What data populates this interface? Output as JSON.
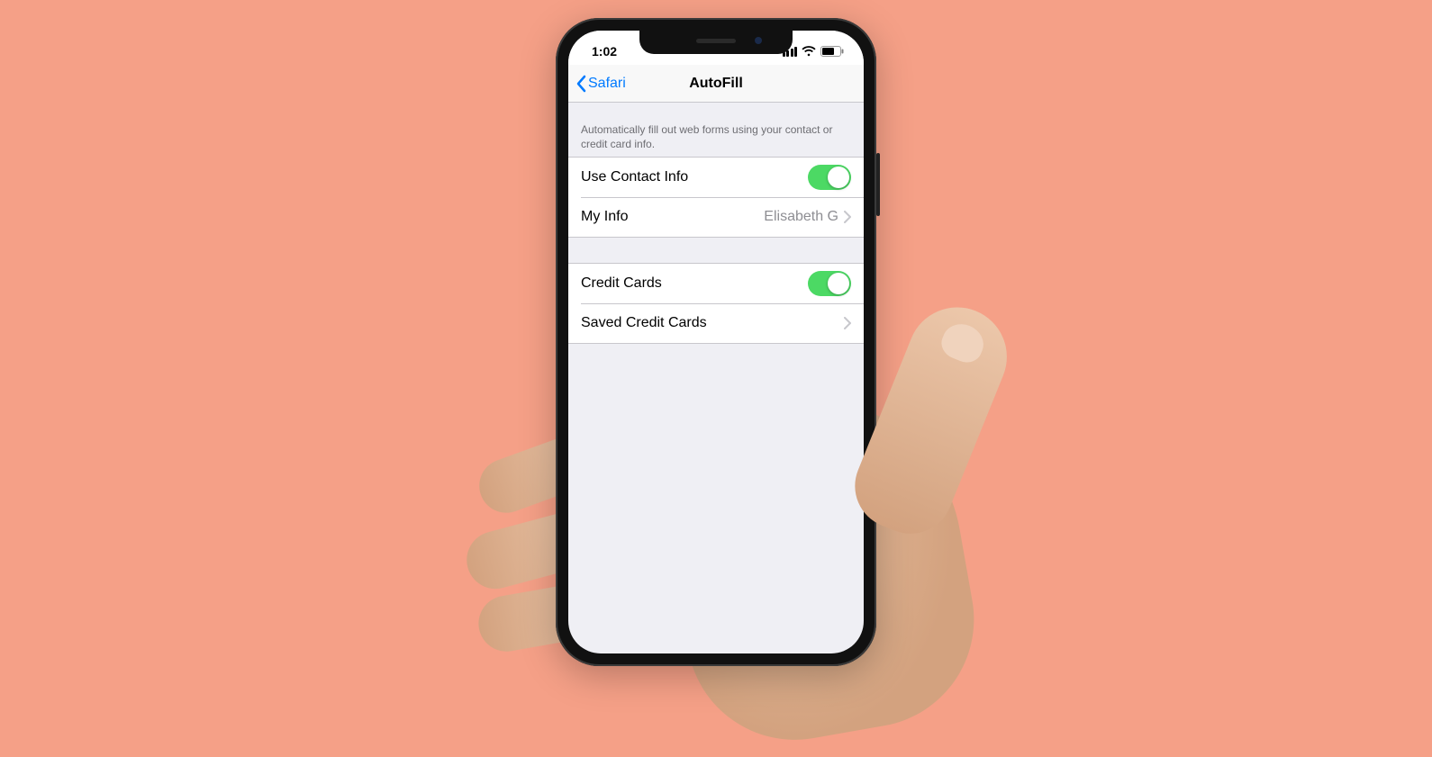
{
  "statusbar": {
    "time": "1:02"
  },
  "nav": {
    "back_label": "Safari",
    "title": "AutoFill"
  },
  "section_caption": "Automatically fill out web forms using your contact or credit card info.",
  "contact_group": {
    "use_contact_label": "Use Contact Info",
    "use_contact_on": true,
    "my_info_label": "My Info",
    "my_info_value": "Elisabeth G"
  },
  "cc_group": {
    "credit_cards_label": "Credit Cards",
    "credit_cards_on": true,
    "saved_label": "Saved Credit Cards"
  }
}
